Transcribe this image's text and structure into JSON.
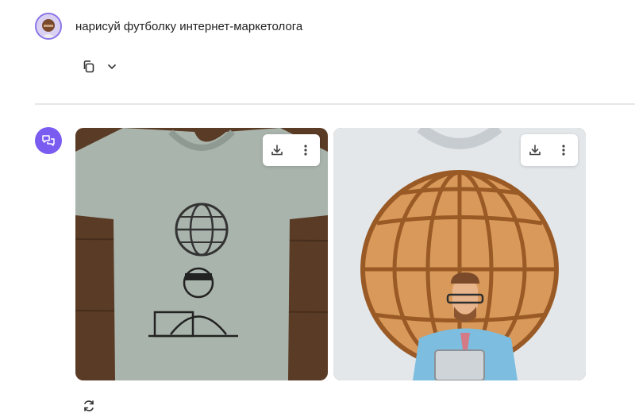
{
  "user_message": {
    "text": "нарисуй футболку интернет-маркетолога",
    "avatar_icon": "user-avatar"
  },
  "message_actions": {
    "copy_icon": "copy-icon",
    "more_icon": "chevron-down-icon"
  },
  "assistant": {
    "avatar_icon": "chat-bubbles-icon",
    "avatar_color": "#7a5cf0",
    "images": [
      {
        "description_icon": "tshirt-globe-line-art-image",
        "shirt_color": "#a9b4ac",
        "background_color": "#5a3b26",
        "actions": [
          "download-icon",
          "more-vertical-icon"
        ]
      },
      {
        "description_icon": "tshirt-orange-globe-image",
        "shirt_color": "#e3e7ea",
        "background_color": "#7a4e32",
        "actions": [
          "download-icon",
          "more-vertical-icon"
        ]
      }
    ],
    "regenerate_icon": "refresh-icon"
  }
}
